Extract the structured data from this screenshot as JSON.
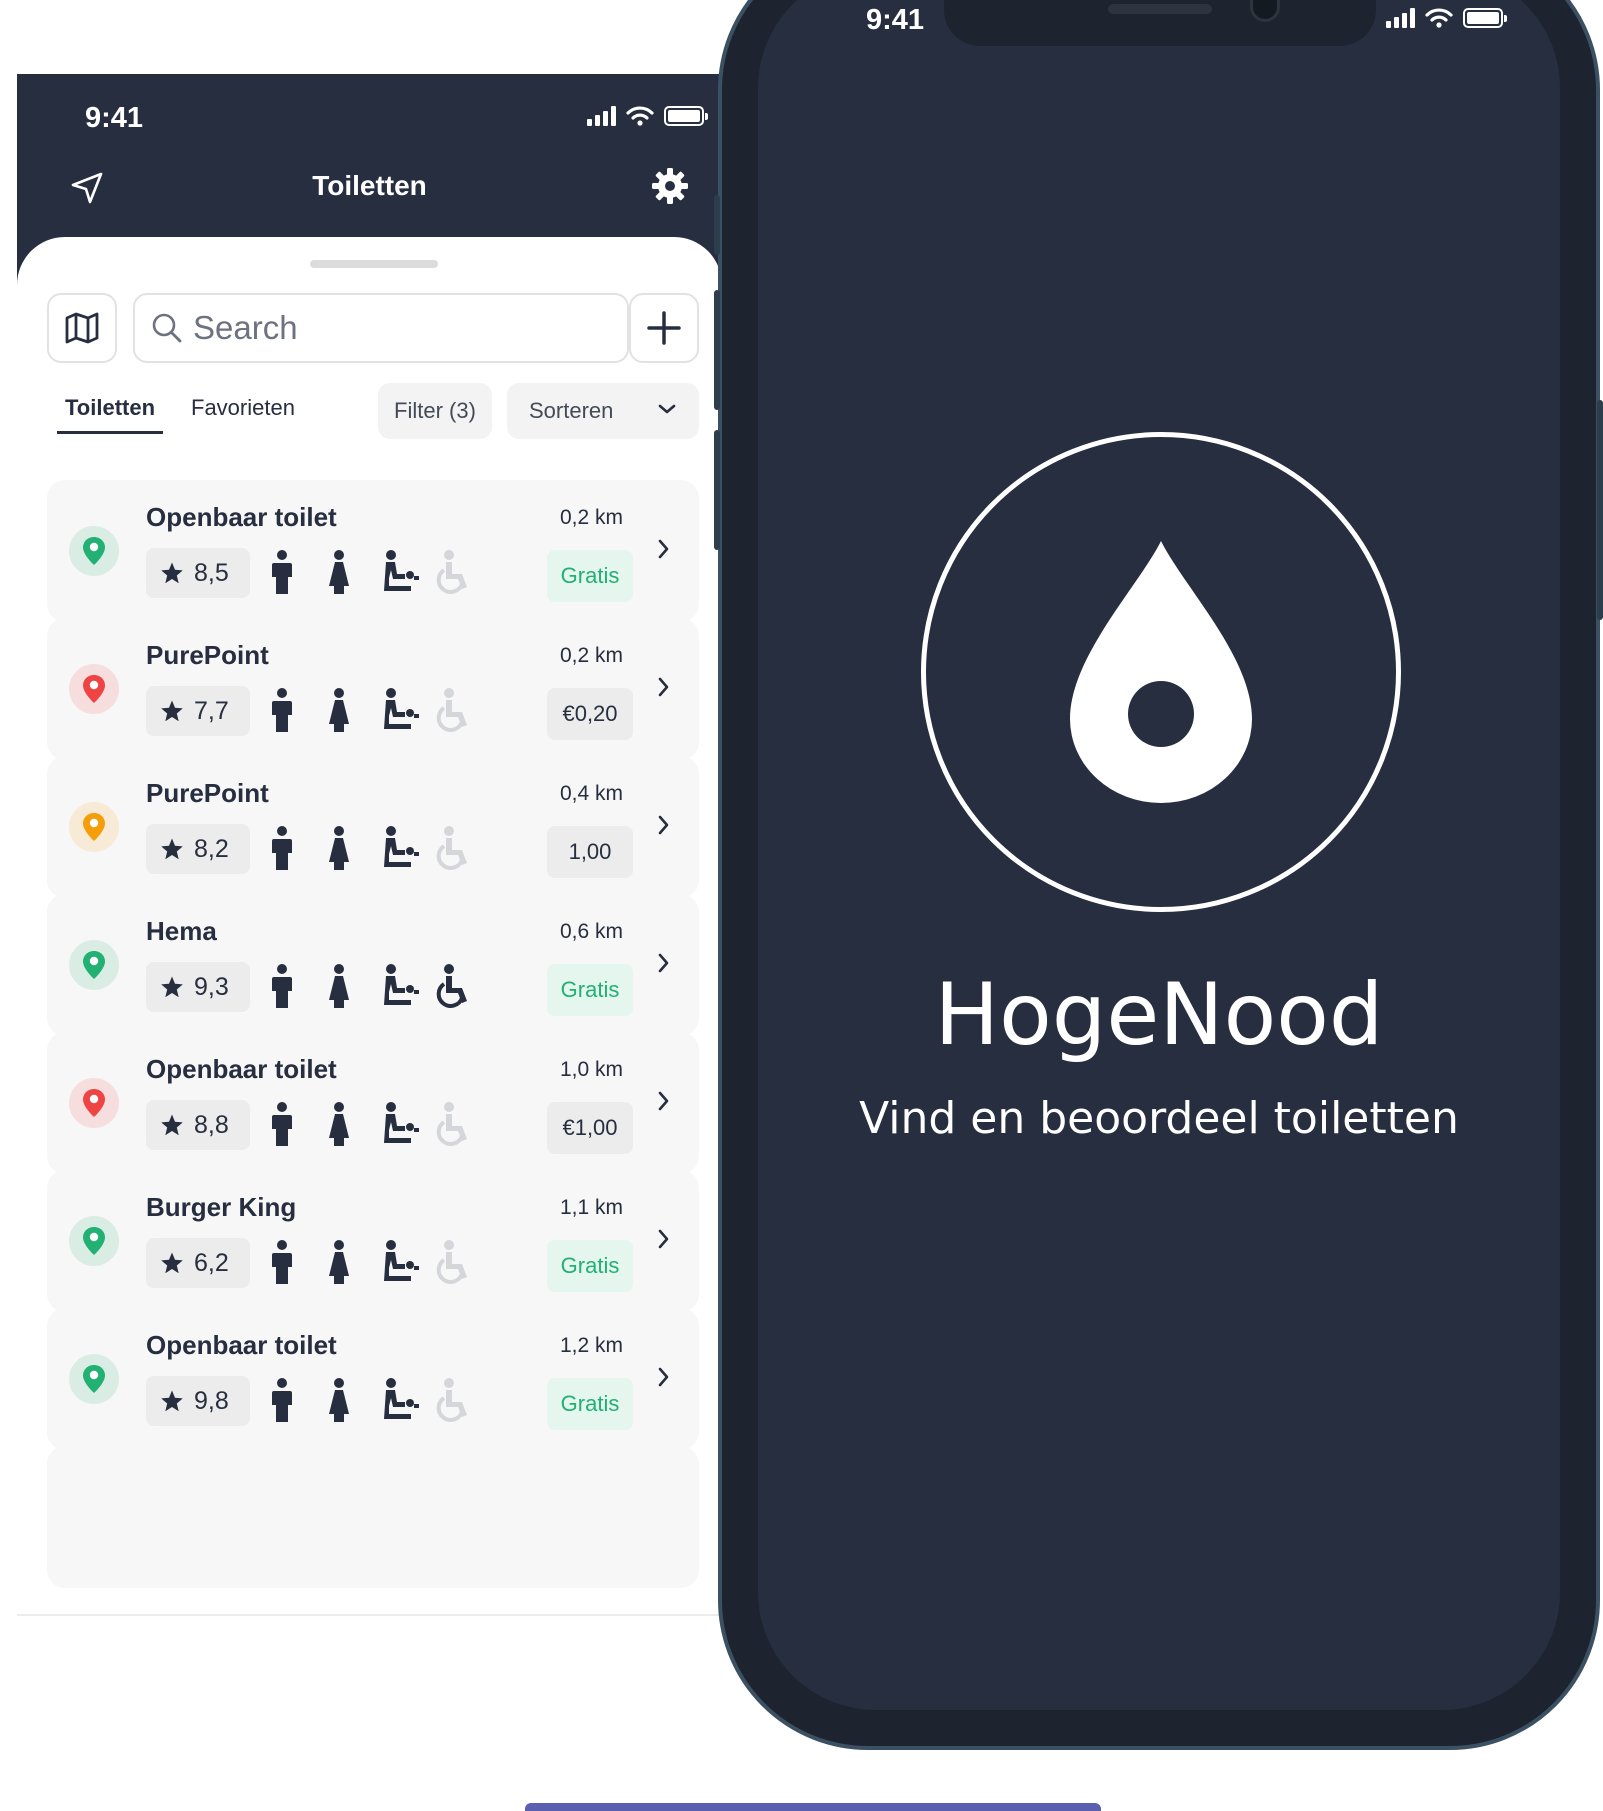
{
  "left_phone": {
    "status": {
      "time": "9:41"
    },
    "header": {
      "title": "Toiletten"
    },
    "search": {
      "placeholder": "Search"
    },
    "tabs": [
      {
        "label": "Toiletten",
        "active": true
      },
      {
        "label": "Favorieten",
        "active": false
      }
    ],
    "filter_label": "Filter (3)",
    "sort_label": "Sorteren",
    "toilets": [
      {
        "name": "Openbaar toilet",
        "distance": "0,2 km",
        "rating": "8,5",
        "price": "Gratis",
        "free": true,
        "pin_color": "#22b073",
        "wheelchair": false
      },
      {
        "name": "PurePoint",
        "distance": "0,2 km",
        "rating": "7,7",
        "price": "€0,20",
        "free": false,
        "pin_color": "#ef4444",
        "wheelchair": false
      },
      {
        "name": "PurePoint",
        "distance": "0,4 km",
        "rating": "8,2",
        "price": "1,00",
        "free": false,
        "pin_color": "#f59e0b",
        "wheelchair": false
      },
      {
        "name": "Hema",
        "distance": "0,6 km",
        "rating": "9,3",
        "price": "Gratis",
        "free": true,
        "pin_color": "#22b073",
        "wheelchair": true
      },
      {
        "name": "Openbaar toilet",
        "distance": "1,0 km",
        "rating": "8,8",
        "price": "€1,00",
        "free": false,
        "pin_color": "#ef4444",
        "wheelchair": false
      },
      {
        "name": "Burger King",
        "distance": "1,1 km",
        "rating": "6,2",
        "price": "Gratis",
        "free": true,
        "pin_color": "#22b073",
        "wheelchair": false
      },
      {
        "name": "Openbaar toilet",
        "distance": "1,2 km",
        "rating": "9,8",
        "price": "Gratis",
        "free": true,
        "pin_color": "#22b073",
        "wheelchair": false
      }
    ]
  },
  "right_phone": {
    "status": {
      "time": "9:41"
    },
    "app_name": "HogeNood",
    "tagline": "Vind en beoordeel toiletten"
  },
  "colors": {
    "navy": "#272e40",
    "green": "#22b073",
    "red": "#ef4444",
    "orange": "#f59e0b",
    "accent_bar": "#5a5fb0"
  }
}
